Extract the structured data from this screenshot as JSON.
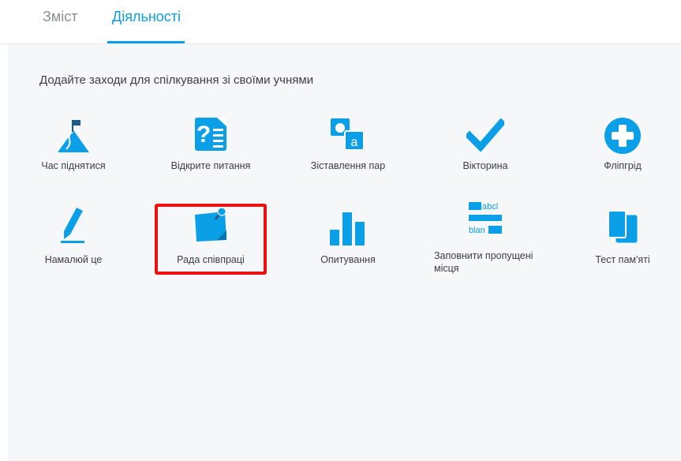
{
  "tabs": [
    {
      "label": "Зміст"
    },
    {
      "label": "Діяльності"
    }
  ],
  "heading": "Додайте заходи для спілкування зі своїми учнями",
  "colors": {
    "accent": "#0a9fe6",
    "highlight": "#ee1111"
  },
  "activities": [
    {
      "label": "Час піднятися",
      "icon": "mountain-flag-icon"
    },
    {
      "label": "Відкрите питання",
      "icon": "question-document-icon"
    },
    {
      "label": "Зіставлення пар",
      "icon": "match-pairs-icon"
    },
    {
      "label": "Вікторина",
      "icon": "checkmark-icon"
    },
    {
      "label": "Фліпгрід",
      "icon": "plus-circle-icon"
    },
    {
      "label": "Намалюй це",
      "icon": "pencil-icon"
    },
    {
      "label": "Рада співпраці",
      "icon": "sticky-note-icon"
    },
    {
      "label": "Опитування",
      "icon": "bar-chart-icon"
    },
    {
      "label": "Заповнити пропущені місця",
      "icon": "fill-blanks-icon",
      "icon_text_1": "abcl",
      "icon_text_2": "blan"
    },
    {
      "label": "Тест пам'яті",
      "icon": "memory-cards-icon"
    }
  ]
}
